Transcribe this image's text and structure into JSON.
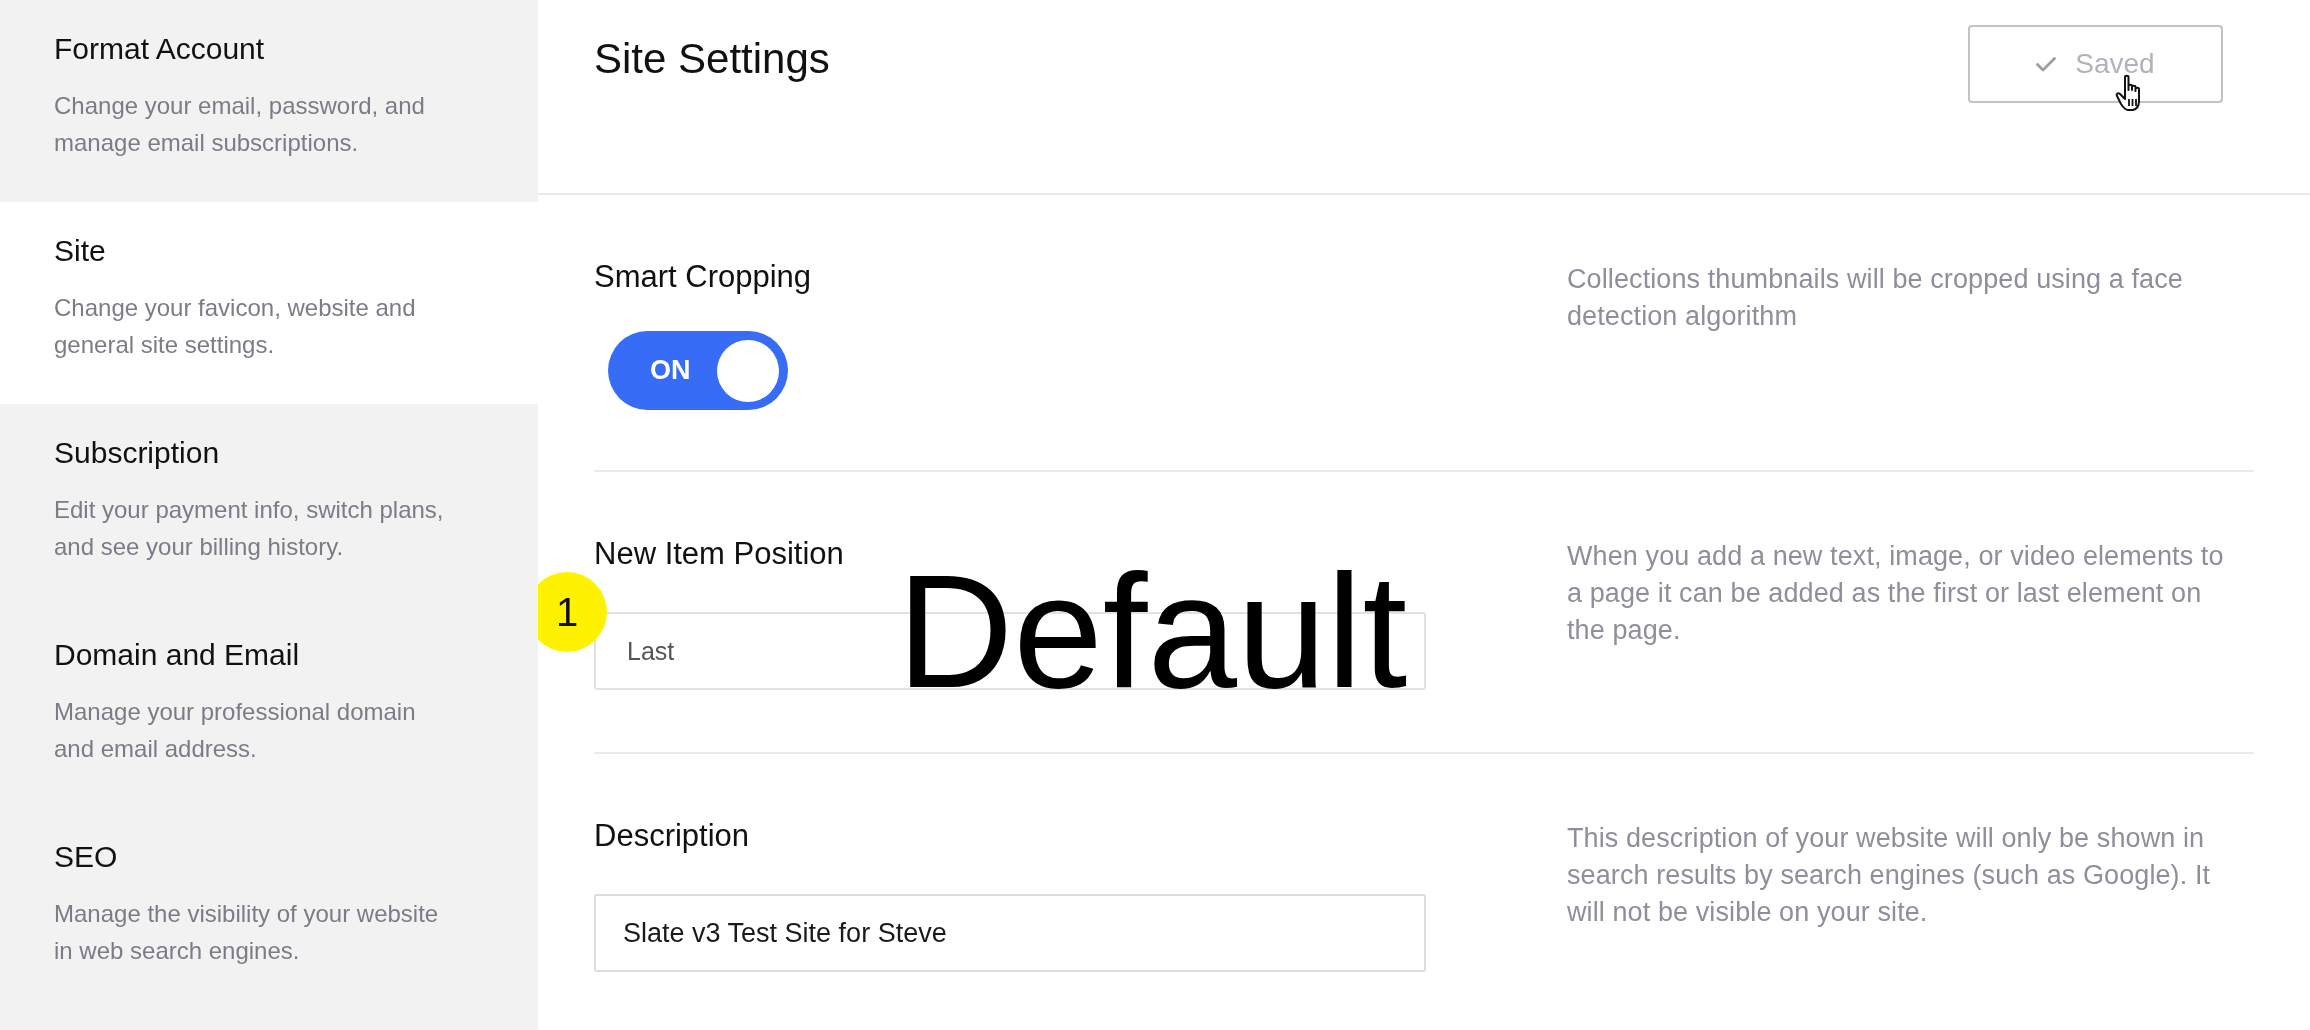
{
  "sidebar": {
    "items": [
      {
        "title": "Format Account",
        "description": "Change your email, password, and manage email subscriptions.",
        "selected": false
      },
      {
        "title": "Site",
        "description": "Change your favicon, website and general site settings.",
        "selected": true
      },
      {
        "title": "Subscription",
        "description": "Edit your payment info, switch plans, and see your billing history.",
        "selected": false
      },
      {
        "title": "Domain and Email",
        "description": "Manage your professional domain and email address.",
        "selected": false
      },
      {
        "title": "SEO",
        "description": "Manage the visibility of your website in web search engines.",
        "selected": false
      }
    ]
  },
  "header": {
    "title": "Site Settings",
    "save_button": {
      "label": "Saved",
      "disabled": true
    }
  },
  "settings": [
    {
      "kind": "toggle",
      "label": "Smart Cropping",
      "switch": {
        "label": "ON",
        "on": true
      },
      "help": "Collections thumbnails will be cropped using a face detection algorithm"
    },
    {
      "kind": "select",
      "label": "New Item Position",
      "value": "Last",
      "step_badge": "1",
      "overlay_caption": "Default",
      "help": "When you add a new text, image, or video elements to a page it can be added as the first or last element on the page."
    },
    {
      "kind": "text",
      "label": "Description",
      "value": "Slate v3 Test Site for Steve",
      "help": "This description of your website will only be shown in search results by search engines (such as Google). It will not be visible on your site."
    }
  ]
}
